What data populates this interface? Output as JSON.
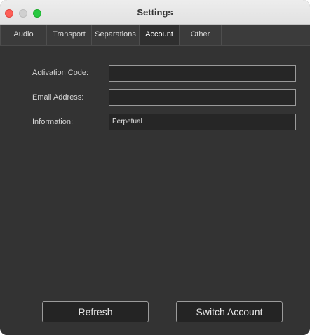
{
  "window": {
    "title": "Settings"
  },
  "tabs": [
    {
      "label": "Audio"
    },
    {
      "label": "Transport"
    },
    {
      "label": "Separations"
    },
    {
      "label": "Account",
      "active": true
    },
    {
      "label": "Other"
    }
  ],
  "account": {
    "activation_code": {
      "label": "Activation Code:",
      "value": ""
    },
    "email": {
      "label": "Email Address:",
      "value": ""
    },
    "information": {
      "label": "Information:",
      "value": "Perpetual"
    }
  },
  "buttons": {
    "refresh": "Refresh",
    "switch_account": "Switch Account"
  },
  "colors": {
    "panel_bg": "#333333",
    "input_bg": "#262626",
    "close": "#fe5f57",
    "zoom": "#28c840"
  }
}
